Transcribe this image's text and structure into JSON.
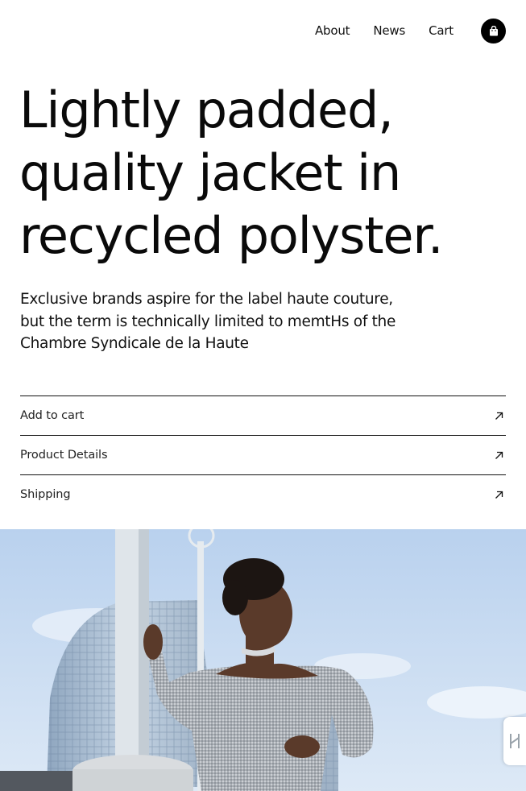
{
  "nav": {
    "items": [
      {
        "label": "About"
      },
      {
        "label": "News"
      },
      {
        "label": "Cart"
      }
    ],
    "cart_icon": "shopping-bag-icon"
  },
  "hero": {
    "title": "Lightly padded, quality jacket in recycled polyster.",
    "description": "Exclusive brands aspire for the label haute couture, but the term is technically limited to memtHs of the Chambre Syndicale de la Haute"
  },
  "accordion": {
    "items": [
      {
        "label": "Add to cart",
        "icon": "arrow-up-right-icon"
      },
      {
        "label": "Product Details",
        "icon": "arrow-up-right-icon"
      },
      {
        "label": "Shipping",
        "icon": "arrow-up-right-icon"
      }
    ]
  },
  "image": {
    "subject": "model-photo"
  },
  "side_tab": {
    "icon": "widget-logo-icon"
  },
  "colors": {
    "accent": "#000000",
    "sky": "#c9dcf0",
    "text": "#0a0a0a"
  }
}
